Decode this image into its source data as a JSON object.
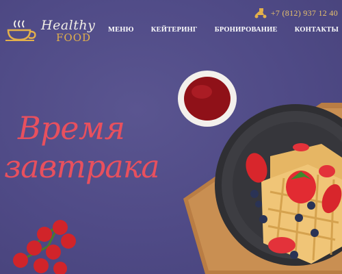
{
  "logo": {
    "line1": "Healthy",
    "line2": "FOOD"
  },
  "header": {
    "phone": "+7 (812) 937 12 40"
  },
  "nav": {
    "items": [
      {
        "label": "МЕНЮ"
      },
      {
        "label": "КЕЙТЕРИНГ"
      },
      {
        "label": "БРОНИРОВАНИЕ"
      },
      {
        "label": "КОНТАКТЫ"
      }
    ]
  },
  "hero": {
    "title_line1": "Время",
    "title_line2": "завтрака"
  },
  "colors": {
    "background": "#4f4a86",
    "accent": "#e8505e",
    "gold": "#e3b04b"
  },
  "icons": {
    "logo": "teacup-icon",
    "phone": "delivery-scooter-icon"
  }
}
